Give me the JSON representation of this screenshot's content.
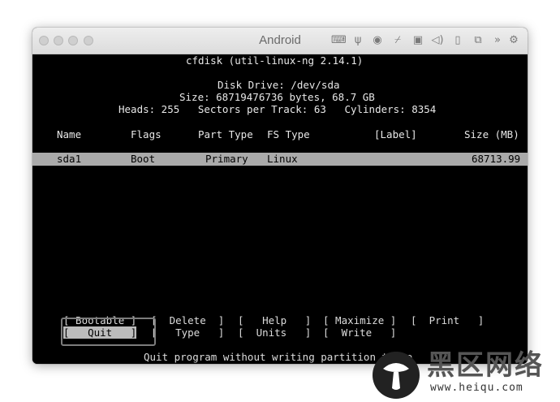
{
  "window": {
    "title": "Android",
    "toolbar_icons": [
      "keyboard-icon",
      "usb-icon",
      "disc-icon",
      "network-icon",
      "shared-folder-icon",
      "audio-icon",
      "phone-icon",
      "screenshot-icon",
      "more-icon",
      "settings-icon"
    ]
  },
  "terminal": {
    "program_title": "cfdisk (util-linux-ng 2.14.1)",
    "disk_drive": "Disk Drive: /dev/sda",
    "disk_size": "Size: 68719476736 bytes, 68.7 GB",
    "geometry": "Heads: 255   Sectors per Track: 63   Cylinders: 8354",
    "columns": {
      "name": "Name",
      "flags": "Flags",
      "part_type": "Part Type",
      "fs_type": "FS Type",
      "label": "[Label]",
      "size": "Size (MB)"
    },
    "partitions": [
      {
        "name": "sda1",
        "flags": "Boot",
        "part_type": "Primary",
        "fs_type": "Linux",
        "label": "",
        "size": "68713.99"
      }
    ],
    "menu": {
      "bootable": "[ Bootable ]",
      "delete": "[  Delete  ]",
      "help": "[   Help   ]",
      "maximize": "[ Maximize ]",
      "print": "[  Print   ]",
      "quit": "[   Quit   ]",
      "type": "[   Type   ]",
      "units": "[  Units   ]",
      "write": "[  Write   ]"
    },
    "status": "Quit program without writing partition table"
  },
  "watermark": {
    "text": "黑区网络",
    "url": "www.heiqu.com"
  }
}
